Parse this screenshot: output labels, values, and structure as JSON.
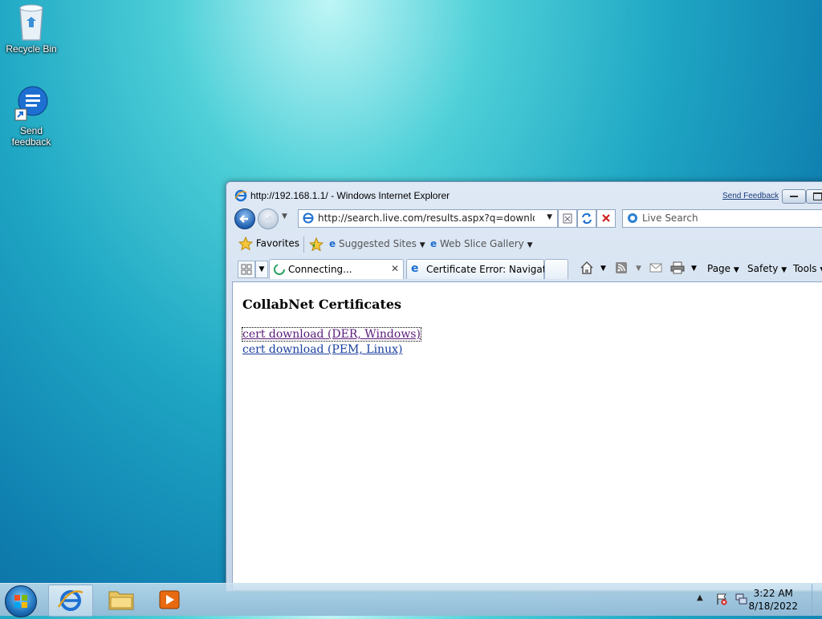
{
  "desktop": {
    "icons": [
      {
        "label": "Recycle Bin"
      },
      {
        "label": "Send feedback"
      }
    ]
  },
  "browser": {
    "title": "http://192.168.1.1/ - Windows Internet Explorer",
    "send_feedback": "Send Feedback",
    "address": "http://search.live.com/results.aspx?q=download+go",
    "search_placeholder": "Live Search",
    "favorites": {
      "favorites_label": "Favorites",
      "suggested_sites": "Suggested Sites",
      "web_slice_gallery": "Web Slice Gallery"
    },
    "tabs": [
      {
        "label": "Connecting..."
      },
      {
        "label": "Certificate Error: Navigati..."
      }
    ],
    "commands": {
      "page": "Page",
      "safety": "Safety",
      "tools": "Tools"
    }
  },
  "page": {
    "heading": "CollabNet Certificates",
    "links": [
      {
        "text": "cert download (DER, Windows)"
      },
      {
        "text": "cert download (PEM, Linux)"
      }
    ]
  },
  "taskbar": {
    "time": "3:22 AM",
    "date": "8/18/2022"
  }
}
